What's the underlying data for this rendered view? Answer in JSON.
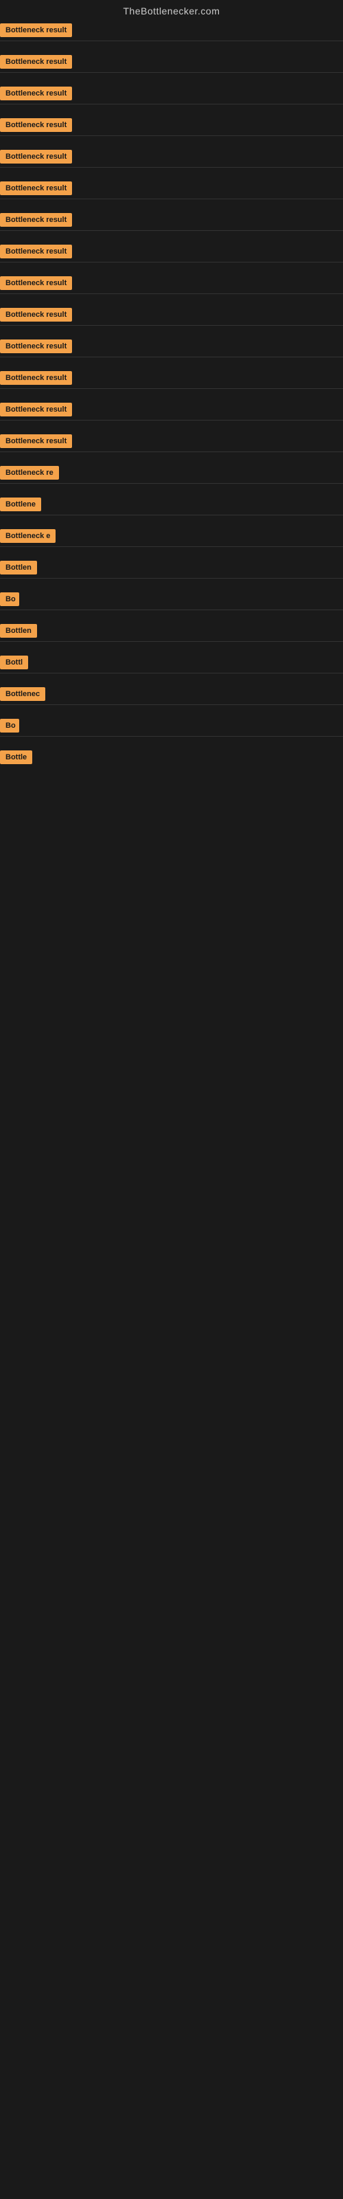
{
  "site": {
    "title": "TheBottlenecker.com"
  },
  "items": [
    {
      "id": 1,
      "label": "Bottleneck result",
      "badge_width": 120
    },
    {
      "id": 2,
      "label": "Bottleneck result",
      "badge_width": 120
    },
    {
      "id": 3,
      "label": "Bottleneck result",
      "badge_width": 120
    },
    {
      "id": 4,
      "label": "Bottleneck result",
      "badge_width": 120
    },
    {
      "id": 5,
      "label": "Bottleneck result",
      "badge_width": 120
    },
    {
      "id": 6,
      "label": "Bottleneck result",
      "badge_width": 120
    },
    {
      "id": 7,
      "label": "Bottleneck result",
      "badge_width": 120
    },
    {
      "id": 8,
      "label": "Bottleneck result",
      "badge_width": 120
    },
    {
      "id": 9,
      "label": "Bottleneck result",
      "badge_width": 120
    },
    {
      "id": 10,
      "label": "Bottleneck result",
      "badge_width": 120
    },
    {
      "id": 11,
      "label": "Bottleneck result",
      "badge_width": 120
    },
    {
      "id": 12,
      "label": "Bottleneck result",
      "badge_width": 120
    },
    {
      "id": 13,
      "label": "Bottleneck result",
      "badge_width": 120
    },
    {
      "id": 14,
      "label": "Bottleneck result",
      "badge_width": 120
    },
    {
      "id": 15,
      "label": "Bottleneck re",
      "badge_width": 90
    },
    {
      "id": 16,
      "label": "Bottlene",
      "badge_width": 70
    },
    {
      "id": 17,
      "label": "Bottleneck e",
      "badge_width": 82
    },
    {
      "id": 18,
      "label": "Bottlen",
      "badge_width": 58
    },
    {
      "id": 19,
      "label": "Bo",
      "badge_width": 28
    },
    {
      "id": 20,
      "label": "Bottlen",
      "badge_width": 58
    },
    {
      "id": 21,
      "label": "Bottl",
      "badge_width": 44
    },
    {
      "id": 22,
      "label": "Bottlenec",
      "badge_width": 72
    },
    {
      "id": 23,
      "label": "Bo",
      "badge_width": 28
    },
    {
      "id": 24,
      "label": "Bottle",
      "badge_width": 50
    }
  ]
}
